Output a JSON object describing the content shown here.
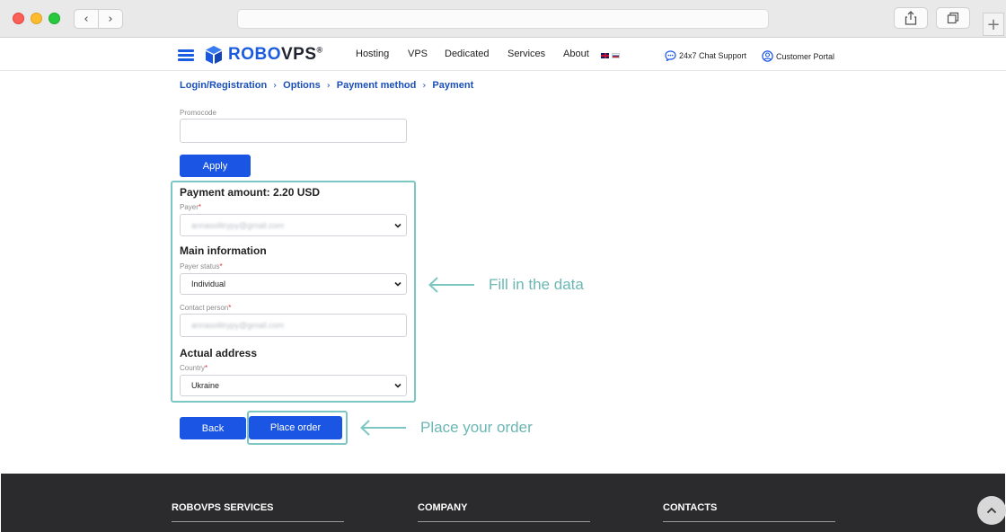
{
  "browser": {
    "back_glyph": "‹",
    "forward_glyph": "›",
    "new_tab_glyph": "+",
    "url": ""
  },
  "header": {
    "logo": {
      "part1": "ROBO",
      "part2": "VPS",
      "mark": "®"
    },
    "nav": [
      "Hosting",
      "VPS",
      "Dedicated",
      "Services",
      "About"
    ],
    "support_label": "24x7 Chat Support",
    "portal_label": "Customer Portal"
  },
  "breadcrumb": {
    "items": [
      "Login/Registration",
      "Options",
      "Payment method",
      "Payment"
    ],
    "separator": "›"
  },
  "form": {
    "promocode_label": "Promocode",
    "promocode_value": "",
    "apply_label": "Apply",
    "payment_amount": "Payment amount: 2.20 USD",
    "payer_label": "Payer",
    "payer_value": "annasolitrypy@gmail.com",
    "main_info_title": "Main information",
    "payer_status_label": "Payer status",
    "payer_status_value": "Individual",
    "contact_person_label": "Contact person",
    "contact_person_value": "annasolitrypy@gmail.com",
    "actual_address_title": "Actual address",
    "country_label": "Country",
    "country_value": "Ukraine",
    "required_mark": "*",
    "back_label": "Back",
    "place_order_label": "Place order"
  },
  "callouts": {
    "fill_data": "Fill in the data",
    "place_order": "Place your order"
  },
  "footer": {
    "columns": [
      "ROBOVPS SERVICES",
      "COMPANY",
      "CONTACTS"
    ]
  },
  "colors": {
    "brand_blue": "#1a55e3",
    "highlight_teal": "#7cc7c4",
    "footer_bg": "#2b2b2d"
  }
}
